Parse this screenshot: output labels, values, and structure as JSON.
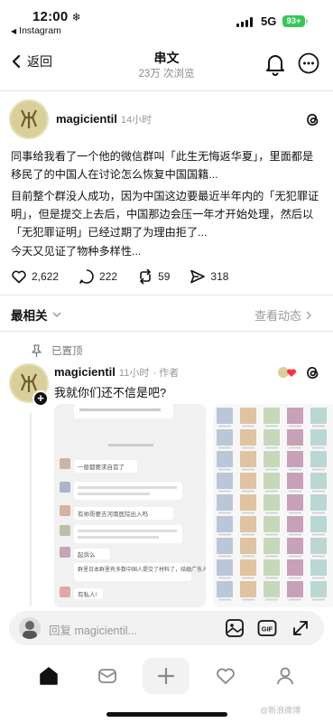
{
  "status_bar": {
    "time": "12:00",
    "back_app": "Instagram",
    "network": "5G",
    "battery": "93+"
  },
  "nav": {
    "back_label": "返回",
    "title": "串文",
    "views": "23万 次浏览"
  },
  "post": {
    "username": "magicientil",
    "time": "14小时",
    "paragraphs": [
      "同事给我看了一个他的微信群叫「此生无悔返华夏」，里面都是移民了的中国人在讨论怎么恢复中国国籍...",
      "目前整个群没人成功，因为中国这边要最近半年内的「无犯罪证明」，但是提交上去后，中国那边会压一年才开始处理，然后以「无犯罪证明」已经过期了为理由拒了...",
      "今天又见证了物种多样性..."
    ],
    "likes": "2,622",
    "comments": "222",
    "reposts": "59",
    "shares": "318"
  },
  "related": {
    "label": "最相关",
    "activity": "查看动态"
  },
  "reply": {
    "pinned": "已置顶",
    "username": "magicientil",
    "time": "11小时",
    "author_tag": "· 作者",
    "text": "我就你们还不信是吧?",
    "chat_lines": [
      "一般都要求自首了",
      "有帅哥要去河南医院出入吗",
      "起诉么",
      "群里日本群里有多数中国人提交了材料了，结婚广东人",
      "有私人!"
    ]
  },
  "reply_bar": {
    "placeholder": "回复 magicientil..."
  },
  "watermark": "@新浪微博"
}
